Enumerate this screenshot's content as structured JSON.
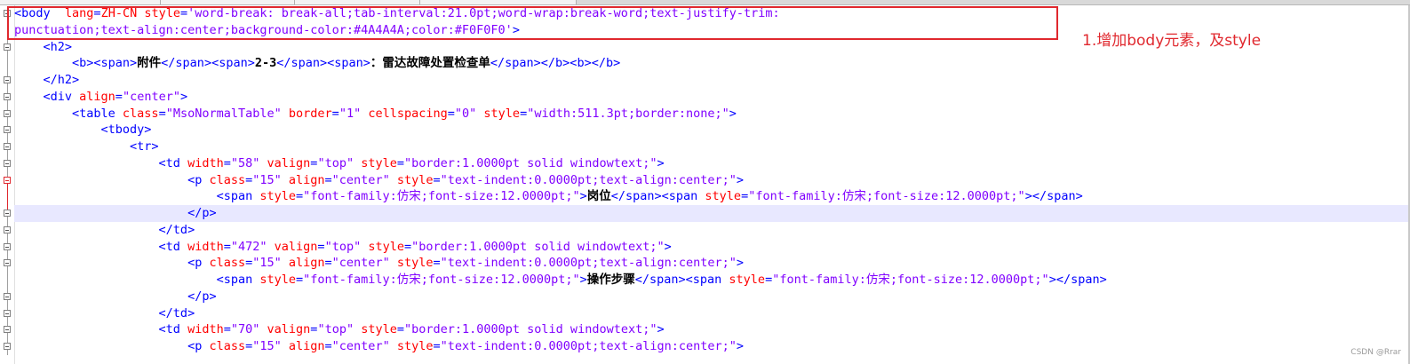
{
  "code_lines": [
    {
      "folded_marker": true,
      "segments": [
        {
          "t": "<body  ",
          "c": "tag"
        },
        {
          "t": "lang",
          "c": "attr"
        },
        {
          "t": "=",
          "c": "tag"
        },
        {
          "t": "ZH-CN",
          "c": "attr"
        },
        {
          "t": " ",
          "c": "tag"
        },
        {
          "t": "style",
          "c": "attr"
        },
        {
          "t": "=",
          "c": "tag"
        },
        {
          "t": "'word-break: break-all;tab-interval:21.0pt;word-wrap:break-word;text-justify-trim:",
          "c": "val"
        }
      ]
    },
    {
      "segments": [
        {
          "t": "punctuation;text-align:center;background-color:#4A4A4A;color:#F0F0F0'",
          "c": "val"
        },
        {
          "t": ">",
          "c": "tag"
        }
      ]
    },
    {
      "segments": [
        {
          "t": "    <h2>",
          "c": "tag"
        }
      ]
    },
    {
      "segments": [
        {
          "t": "        <b><span>",
          "c": "tag"
        },
        {
          "t": "附件",
          "c": "txt"
        },
        {
          "t": "</span><span>",
          "c": "tag"
        },
        {
          "t": "2-3",
          "c": "txt"
        },
        {
          "t": "</span><span>",
          "c": "tag"
        },
        {
          "t": "：雷达故障处置检查单",
          "c": "txt"
        },
        {
          "t": "</span></b><b></b>",
          "c": "tag"
        }
      ]
    },
    {
      "segments": [
        {
          "t": "    </h2>",
          "c": "tag"
        }
      ]
    },
    {
      "segments": [
        {
          "t": "    <div ",
          "c": "tag"
        },
        {
          "t": "align",
          "c": "attr"
        },
        {
          "t": "=",
          "c": "tag"
        },
        {
          "t": "\"center\"",
          "c": "val"
        },
        {
          "t": ">",
          "c": "tag"
        }
      ]
    },
    {
      "segments": [
        {
          "t": "        <table ",
          "c": "tag"
        },
        {
          "t": "class",
          "c": "attr"
        },
        {
          "t": "=",
          "c": "tag"
        },
        {
          "t": "\"MsoNormalTable\"",
          "c": "val"
        },
        {
          "t": " ",
          "c": "tag"
        },
        {
          "t": "border",
          "c": "attr"
        },
        {
          "t": "=",
          "c": "tag"
        },
        {
          "t": "\"1\"",
          "c": "val"
        },
        {
          "t": " ",
          "c": "tag"
        },
        {
          "t": "cellspacing",
          "c": "attr"
        },
        {
          "t": "=",
          "c": "tag"
        },
        {
          "t": "\"0\"",
          "c": "val"
        },
        {
          "t": " ",
          "c": "tag"
        },
        {
          "t": "style",
          "c": "attr"
        },
        {
          "t": "=",
          "c": "tag"
        },
        {
          "t": "\"width:511.3pt;border:none;\"",
          "c": "val"
        },
        {
          "t": ">",
          "c": "tag"
        }
      ]
    },
    {
      "segments": [
        {
          "t": "            <tbody>",
          "c": "tag"
        }
      ]
    },
    {
      "segments": [
        {
          "t": "                <tr>",
          "c": "tag"
        }
      ]
    },
    {
      "segments": [
        {
          "t": "                    <td ",
          "c": "tag"
        },
        {
          "t": "width",
          "c": "attr"
        },
        {
          "t": "=",
          "c": "tag"
        },
        {
          "t": "\"58\"",
          "c": "val"
        },
        {
          "t": " ",
          "c": "tag"
        },
        {
          "t": "valign",
          "c": "attr"
        },
        {
          "t": "=",
          "c": "tag"
        },
        {
          "t": "\"top\"",
          "c": "val"
        },
        {
          "t": " ",
          "c": "tag"
        },
        {
          "t": "style",
          "c": "attr"
        },
        {
          "t": "=",
          "c": "tag"
        },
        {
          "t": "\"border:1.0000pt solid windowtext;\"",
          "c": "val"
        },
        {
          "t": ">",
          "c": "tag"
        }
      ]
    },
    {
      "segments": [
        {
          "t": "                        <p ",
          "c": "tag"
        },
        {
          "t": "class",
          "c": "attr"
        },
        {
          "t": "=",
          "c": "tag"
        },
        {
          "t": "\"15\"",
          "c": "val"
        },
        {
          "t": " ",
          "c": "tag"
        },
        {
          "t": "align",
          "c": "attr"
        },
        {
          "t": "=",
          "c": "tag"
        },
        {
          "t": "\"center\"",
          "c": "val"
        },
        {
          "t": " ",
          "c": "tag"
        },
        {
          "t": "style",
          "c": "attr"
        },
        {
          "t": "=",
          "c": "tag"
        },
        {
          "t": "\"text-indent:0.0000pt;text-align:center;\"",
          "c": "val"
        },
        {
          "t": ">",
          "c": "tag"
        }
      ]
    },
    {
      "segments": [
        {
          "t": "                            <span ",
          "c": "tag"
        },
        {
          "t": "style",
          "c": "attr"
        },
        {
          "t": "=",
          "c": "tag"
        },
        {
          "t": "\"font-family:仿宋;font-size:12.0000pt;\"",
          "c": "val"
        },
        {
          "t": ">",
          "c": "tag"
        },
        {
          "t": "岗位",
          "c": "txt"
        },
        {
          "t": "</span><span ",
          "c": "tag"
        },
        {
          "t": "style",
          "c": "attr"
        },
        {
          "t": "=",
          "c": "tag"
        },
        {
          "t": "\"font-family:仿宋;font-size:12.0000pt;\"",
          "c": "val"
        },
        {
          "t": "></span>",
          "c": "tag"
        }
      ]
    },
    {
      "current": true,
      "segments": [
        {
          "t": "                        </p>",
          "c": "tag"
        }
      ]
    },
    {
      "segments": [
        {
          "t": "                    </td>",
          "c": "tag"
        }
      ]
    },
    {
      "segments": [
        {
          "t": "                    <td ",
          "c": "tag"
        },
        {
          "t": "width",
          "c": "attr"
        },
        {
          "t": "=",
          "c": "tag"
        },
        {
          "t": "\"472\"",
          "c": "val"
        },
        {
          "t": " ",
          "c": "tag"
        },
        {
          "t": "valign",
          "c": "attr"
        },
        {
          "t": "=",
          "c": "tag"
        },
        {
          "t": "\"top\"",
          "c": "val"
        },
        {
          "t": " ",
          "c": "tag"
        },
        {
          "t": "style",
          "c": "attr"
        },
        {
          "t": "=",
          "c": "tag"
        },
        {
          "t": "\"border:1.0000pt solid windowtext;\"",
          "c": "val"
        },
        {
          "t": ">",
          "c": "tag"
        }
      ]
    },
    {
      "segments": [
        {
          "t": "                        <p ",
          "c": "tag"
        },
        {
          "t": "class",
          "c": "attr"
        },
        {
          "t": "=",
          "c": "tag"
        },
        {
          "t": "\"15\"",
          "c": "val"
        },
        {
          "t": " ",
          "c": "tag"
        },
        {
          "t": "align",
          "c": "attr"
        },
        {
          "t": "=",
          "c": "tag"
        },
        {
          "t": "\"center\"",
          "c": "val"
        },
        {
          "t": " ",
          "c": "tag"
        },
        {
          "t": "style",
          "c": "attr"
        },
        {
          "t": "=",
          "c": "tag"
        },
        {
          "t": "\"text-indent:0.0000pt;text-align:center;\"",
          "c": "val"
        },
        {
          "t": ">",
          "c": "tag"
        }
      ]
    },
    {
      "segments": [
        {
          "t": "                            <span ",
          "c": "tag"
        },
        {
          "t": "style",
          "c": "attr"
        },
        {
          "t": "=",
          "c": "tag"
        },
        {
          "t": "\"font-family:仿宋;font-size:12.0000pt;\"",
          "c": "val"
        },
        {
          "t": ">",
          "c": "tag"
        },
        {
          "t": "操作步骤",
          "c": "txt"
        },
        {
          "t": "</span><span ",
          "c": "tag"
        },
        {
          "t": "style",
          "c": "attr"
        },
        {
          "t": "=",
          "c": "tag"
        },
        {
          "t": "\"font-family:仿宋;font-size:12.0000pt;\"",
          "c": "val"
        },
        {
          "t": "></span>",
          "c": "tag"
        }
      ]
    },
    {
      "segments": [
        {
          "t": "                        </p>",
          "c": "tag"
        }
      ]
    },
    {
      "segments": [
        {
          "t": "                    </td>",
          "c": "tag"
        }
      ]
    },
    {
      "segments": [
        {
          "t": "                    <td ",
          "c": "tag"
        },
        {
          "t": "width",
          "c": "attr"
        },
        {
          "t": "=",
          "c": "tag"
        },
        {
          "t": "\"70\"",
          "c": "val"
        },
        {
          "t": " ",
          "c": "tag"
        },
        {
          "t": "valign",
          "c": "attr"
        },
        {
          "t": "=",
          "c": "tag"
        },
        {
          "t": "\"top\"",
          "c": "val"
        },
        {
          "t": " ",
          "c": "tag"
        },
        {
          "t": "style",
          "c": "attr"
        },
        {
          "t": "=",
          "c": "tag"
        },
        {
          "t": "\"border:1.0000pt solid windowtext;\"",
          "c": "val"
        },
        {
          "t": ">",
          "c": "tag"
        }
      ]
    },
    {
      "segments": [
        {
          "t": "                        <p ",
          "c": "tag"
        },
        {
          "t": "class",
          "c": "attr"
        },
        {
          "t": "=",
          "c": "tag"
        },
        {
          "t": "\"15\"",
          "c": "val"
        },
        {
          "t": " ",
          "c": "tag"
        },
        {
          "t": "align",
          "c": "attr"
        },
        {
          "t": "=",
          "c": "tag"
        },
        {
          "t": "\"center\"",
          "c": "val"
        },
        {
          "t": " ",
          "c": "tag"
        },
        {
          "t": "style",
          "c": "attr"
        },
        {
          "t": "=",
          "c": "tag"
        },
        {
          "t": "\"text-indent:0.0000pt;text-align:center;\"",
          "c": "val"
        },
        {
          "t": ">",
          "c": "tag"
        }
      ]
    }
  ],
  "annotation": {
    "note": "1.增加body元素，及style"
  },
  "watermark": "CSDN @Rrar",
  "colors": {
    "tag": "#0000ff",
    "attribute": "#ff0000",
    "value": "#8000ff",
    "annotation_red": "#e0282e",
    "current_line": "#e8e8ff"
  }
}
